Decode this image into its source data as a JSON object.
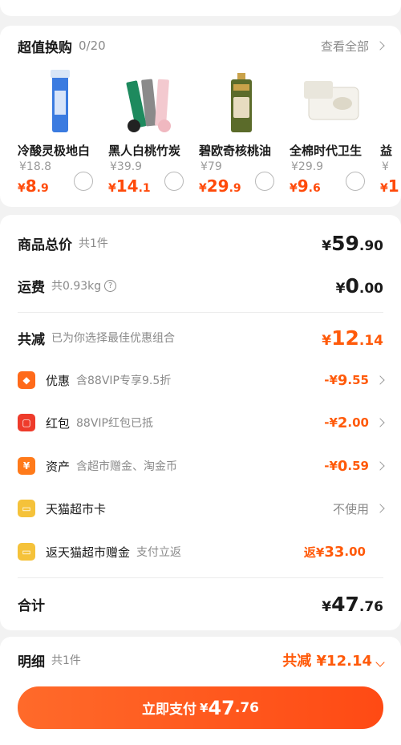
{
  "swap": {
    "title": "超值换购",
    "count": "0/20",
    "view_all": "查看全部",
    "products": [
      {
        "name": "冷酸灵极地白",
        "orig": "¥18.8",
        "price_int": "8",
        "price_dec": ".9",
        "color": "#2c6fd6"
      },
      {
        "name": "黑人白桃竹炭",
        "orig": "¥39.9",
        "price_int": "14",
        "price_dec": ".1",
        "color": "#1e8a5e"
      },
      {
        "name": "碧欧奇核桃油",
        "orig": "¥79",
        "price_int": "29",
        "price_dec": ".9",
        "color": "#5b6b2a"
      },
      {
        "name": "全棉时代卫生",
        "orig": "¥29.9",
        "price_int": "9",
        "price_dec": ".6",
        "color": "#d8d4c8"
      },
      {
        "name": "益",
        "orig": "¥",
        "price_int": "1",
        "price_dec": "",
        "color": "#cccccc"
      }
    ]
  },
  "summary": {
    "total_label": "商品总价",
    "total_sub": "共1件",
    "total_int": "59",
    "total_dec": ".90",
    "ship_label": "运费",
    "ship_sub": "共0.93kg",
    "ship_help": "?",
    "ship_int": "0",
    "ship_dec": ".00",
    "reduce_label": "共减",
    "reduce_sub": "已为你选择最佳优惠组合",
    "reduce_int": "12",
    "reduce_dec": ".14",
    "yen": "¥",
    "details": [
      {
        "icon_char": "◆",
        "icon_color": "#ff6a1a",
        "label": "优惠",
        "sub": "含88VIP专享9.5折",
        "prefix": "-¥",
        "int": "9",
        "dec": ".55"
      },
      {
        "icon_char": "▢",
        "icon_color": "#ee3b2b",
        "label": "红包",
        "sub": "88VIP红包已抵",
        "prefix": "-¥",
        "int": "2",
        "dec": ".00"
      },
      {
        "icon_char": "¥",
        "icon_color": "#ff7a1a",
        "label": "资产",
        "sub": "含超市赠金、淘金币",
        "prefix": "-¥",
        "int": "0",
        "dec": ".59"
      }
    ],
    "tmall_card_label": "天猫超市卡",
    "tmall_card_value": "不使用",
    "rebate_label": "返天猫超市赠金",
    "rebate_sub": "支付立返",
    "rebate_prefix": "返¥",
    "rebate_int": "33",
    "rebate_dec": ".00",
    "sum_label": "合计",
    "sum_int": "47",
    "sum_dec": ".76"
  },
  "bottom": {
    "detail_label": "明细",
    "detail_sub": "共1件",
    "detail_reduce": "共减 ¥12.14",
    "pay_label": "立即支付",
    "pay_yen": "¥",
    "pay_int": "47",
    "pay_dec": ".76"
  },
  "colors": {
    "accent": "#ff5a0a",
    "background": "#f2f2f2"
  }
}
